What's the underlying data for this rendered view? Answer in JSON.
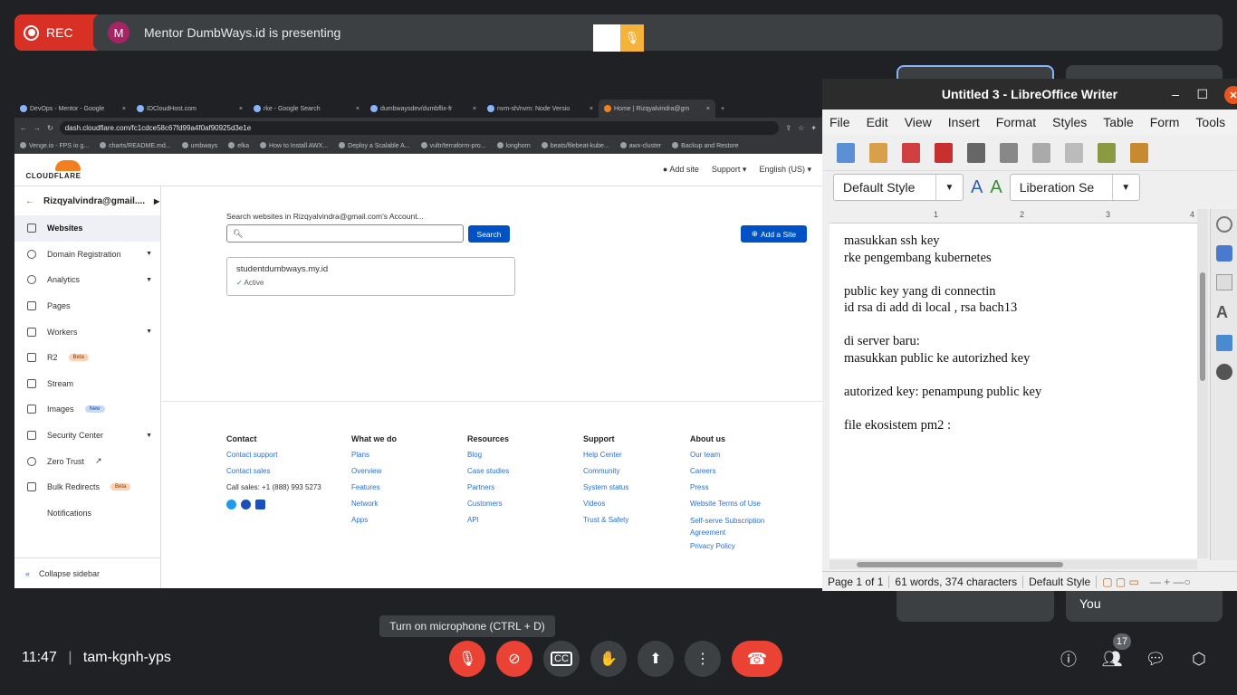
{
  "meet": {
    "rec_label": "REC",
    "presenter_initial": "M",
    "presenting_text": "Mentor DumbWays.id is presenting",
    "tooltip": "Turn on microphone (CTRL + D)",
    "time": "11:47",
    "separator": "|",
    "meeting_code": "tam-kgnh-yps",
    "participants_count": "17",
    "you_label": "You"
  },
  "browser": {
    "tabs": [
      "DevOps - Mentor - Google",
      "IDCloudHost.com",
      "rke - Google Search",
      "dumbwaysdev/dumbflix-fr",
      "nvm-sh/nvm: Node Versio",
      "Home | Rizqyalvindra@gm"
    ],
    "url": "dash.cloudflare.com/fc1cdce58c67fd99a4f0af90925d3e1e",
    "bookmarks": [
      "Venge.io - FPS io g...",
      "charts/README.md...",
      "umbways",
      "elka",
      "How to Install AWX...",
      "Deploy a Scalable A...",
      "vultr/terraform-pro...",
      "longhorn",
      "beats/filebeat-kube...",
      "awx-cluster",
      "Backup and Restore"
    ]
  },
  "cloudflare": {
    "logo_text": "CLOUDFLARE",
    "header_menu": [
      "Add site",
      "Support ▾",
      "English (US) ▾"
    ],
    "account": "Rizqyalvindra@gmail....",
    "sidebar": [
      {
        "label": "Websites",
        "badge": ""
      },
      {
        "label": "Domain Registration",
        "badge": ""
      },
      {
        "label": "Analytics",
        "badge": ""
      },
      {
        "label": "Pages",
        "badge": ""
      },
      {
        "label": "Workers",
        "badge": ""
      },
      {
        "label": "R2",
        "badge": "Beta"
      },
      {
        "label": "Stream",
        "badge": ""
      },
      {
        "label": "Images",
        "badge": "New"
      },
      {
        "label": "Security Center",
        "badge": ""
      },
      {
        "label": "Zero Trust",
        "badge": ""
      },
      {
        "label": "Bulk Redirects",
        "badge": "Beta"
      },
      {
        "label": "Notifications",
        "badge": ""
      }
    ],
    "collapse": "Collapse sidebar",
    "search_label": "Search websites in Rizqyalvindra@gmail.com's Account...",
    "search_button": "Search",
    "add_site_button": "Add a Site",
    "site_name": "studentdumbways.my.id",
    "site_status": "Active",
    "footer": {
      "contact": {
        "title": "Contact",
        "links": [
          "Contact support",
          "Contact sales"
        ],
        "phone": "Call sales: +1 (888) 993 5273"
      },
      "what": {
        "title": "What we do",
        "links": [
          "Plans",
          "Overview",
          "Features",
          "Network",
          "Apps"
        ]
      },
      "resources": {
        "title": "Resources",
        "links": [
          "Blog",
          "Case studies",
          "Partners",
          "Customers",
          "API"
        ]
      },
      "support": {
        "title": "Support",
        "links": [
          "Help Center",
          "Community",
          "System status",
          "Videos",
          "Trust & Safety"
        ]
      },
      "about": {
        "title": "About us",
        "links": [
          "Our team",
          "Careers",
          "Press",
          "Website Terms of Use",
          "Self-serve Subscription",
          "Agreement",
          "Privacy Policy"
        ]
      }
    }
  },
  "writer": {
    "title": "Untitled 3 - LibreOffice Writer",
    "menu": [
      "File",
      "Edit",
      "View",
      "Insert",
      "Format",
      "Styles",
      "Table",
      "Form",
      "Tools"
    ],
    "paragraph_style": "Default Style",
    "font_name": "Liberation Se",
    "lines": [
      "masukkan ssh key",
      "rke pengembang kubernetes",
      "",
      "public key yang di connectin",
      "id rsa di add di local , rsa bach13",
      "",
      "di server baru:",
      "masukkan public ke autorizhed key",
      "",
      "autorized key: penampung public key",
      "",
      "file ekosistem pm2 :"
    ],
    "status": {
      "page": "Page 1 of 1",
      "words": "61 words, 374 characters",
      "style": "Default Style"
    }
  }
}
